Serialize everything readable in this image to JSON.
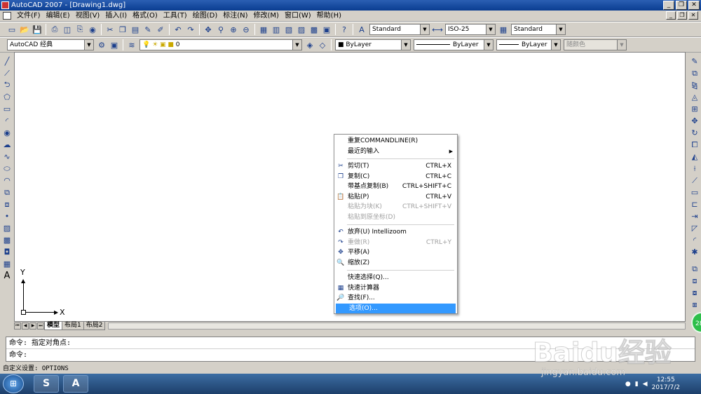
{
  "window": {
    "title": "AutoCAD 2007 - [Drawing1.dwg]",
    "minimize_glyph": "_",
    "restore_glyph": "❐",
    "close_glyph": "✕"
  },
  "menu": [
    "文件(F)",
    "编辑(E)",
    "视图(V)",
    "插入(I)",
    "格式(O)",
    "工具(T)",
    "绘图(D)",
    "标注(N)",
    "修改(M)",
    "窗口(W)",
    "帮助(H)"
  ],
  "toolbar1": {
    "text_style": "Standard",
    "dim_style": "ISO-25",
    "table_style": "Standard",
    "icons": [
      "new-icon",
      "open-icon",
      "save-icon",
      "print-icon",
      "preview-icon",
      "publish-icon",
      "cut-icon",
      "copy-icon",
      "paste-icon",
      "matchprop-icon",
      "undo-icon",
      "redo-icon",
      "pan-icon",
      "zoom-icon",
      "properties-icon",
      "help-icon"
    ]
  },
  "toolbar2": {
    "workspace": "AutoCAD 经典",
    "layer": "0",
    "color": "ByLayer",
    "linetype": "ByLayer",
    "lineweight": "ByLayer",
    "plotstyle": "随颜色"
  },
  "ucs": {
    "x_label": "X",
    "y_label": "Y"
  },
  "layout_tabs": [
    {
      "label": "模型",
      "active": true
    },
    {
      "label": "布局1",
      "active": false
    },
    {
      "label": "布局2",
      "active": false
    }
  ],
  "command": {
    "line1": "命令: 指定对角点:",
    "line2": "命令:"
  },
  "status": {
    "text": "自定义设置:  OPTIONS"
  },
  "context_menu": {
    "items": [
      {
        "label": "重复COMMANDLINE(R)",
        "shortcut": "",
        "icon": "",
        "disabled": false,
        "selected": false,
        "submenu": false
      },
      {
        "label": "最近的输入",
        "shortcut": "",
        "icon": "",
        "disabled": false,
        "selected": false,
        "submenu": true
      },
      {
        "sep": true
      },
      {
        "label": "剪切(T)",
        "shortcut": "CTRL+X",
        "icon": "✂",
        "disabled": false,
        "selected": false,
        "submenu": false
      },
      {
        "label": "复制(C)",
        "shortcut": "CTRL+C",
        "icon": "❐",
        "disabled": false,
        "selected": false,
        "submenu": false
      },
      {
        "label": "带基点复制(B)",
        "shortcut": "CTRL+SHIFT+C",
        "icon": "",
        "disabled": false,
        "selected": false,
        "submenu": false
      },
      {
        "label": "粘贴(P)",
        "shortcut": "CTRL+V",
        "icon": "📋",
        "disabled": false,
        "selected": false,
        "submenu": false
      },
      {
        "label": "粘贴为块(K)",
        "shortcut": "CTRL+SHIFT+V",
        "icon": "",
        "disabled": true,
        "selected": false,
        "submenu": false
      },
      {
        "label": "粘贴到原坐标(D)",
        "shortcut": "",
        "icon": "",
        "disabled": true,
        "selected": false,
        "submenu": false
      },
      {
        "sep": true
      },
      {
        "label": "放弃(U) Intellizoom",
        "shortcut": "",
        "icon": "↶",
        "disabled": false,
        "selected": false,
        "submenu": false
      },
      {
        "label": "重做(R)",
        "shortcut": "CTRL+Y",
        "icon": "↷",
        "disabled": true,
        "selected": false,
        "submenu": false
      },
      {
        "label": "平移(A)",
        "shortcut": "",
        "icon": "✥",
        "disabled": false,
        "selected": false,
        "submenu": false
      },
      {
        "label": "缩放(Z)",
        "shortcut": "",
        "icon": "🔍",
        "disabled": false,
        "selected": false,
        "submenu": false
      },
      {
        "sep": true
      },
      {
        "label": "快速选择(Q)...",
        "shortcut": "",
        "icon": "",
        "disabled": false,
        "selected": false,
        "submenu": false
      },
      {
        "label": "快速计算器",
        "shortcut": "",
        "icon": "▦",
        "disabled": false,
        "selected": false,
        "submenu": false
      },
      {
        "label": "查找(F)...",
        "shortcut": "",
        "icon": "🔎",
        "disabled": false,
        "selected": false,
        "submenu": false
      },
      {
        "label": "选项(O)...",
        "shortcut": "",
        "icon": "",
        "disabled": false,
        "selected": true,
        "submenu": false
      }
    ]
  },
  "taskbar": {
    "time": "12:55",
    "date": "2017/7/2"
  },
  "watermark": {
    "brand": "Baidu经验",
    "url": "jingyan.baidu.com",
    "badge": "28"
  },
  "colors": {
    "title_bar": "#0a3d91",
    "selection": "#3399ff",
    "canvas": "#ffffff",
    "chrome": "#d4d0c8"
  }
}
